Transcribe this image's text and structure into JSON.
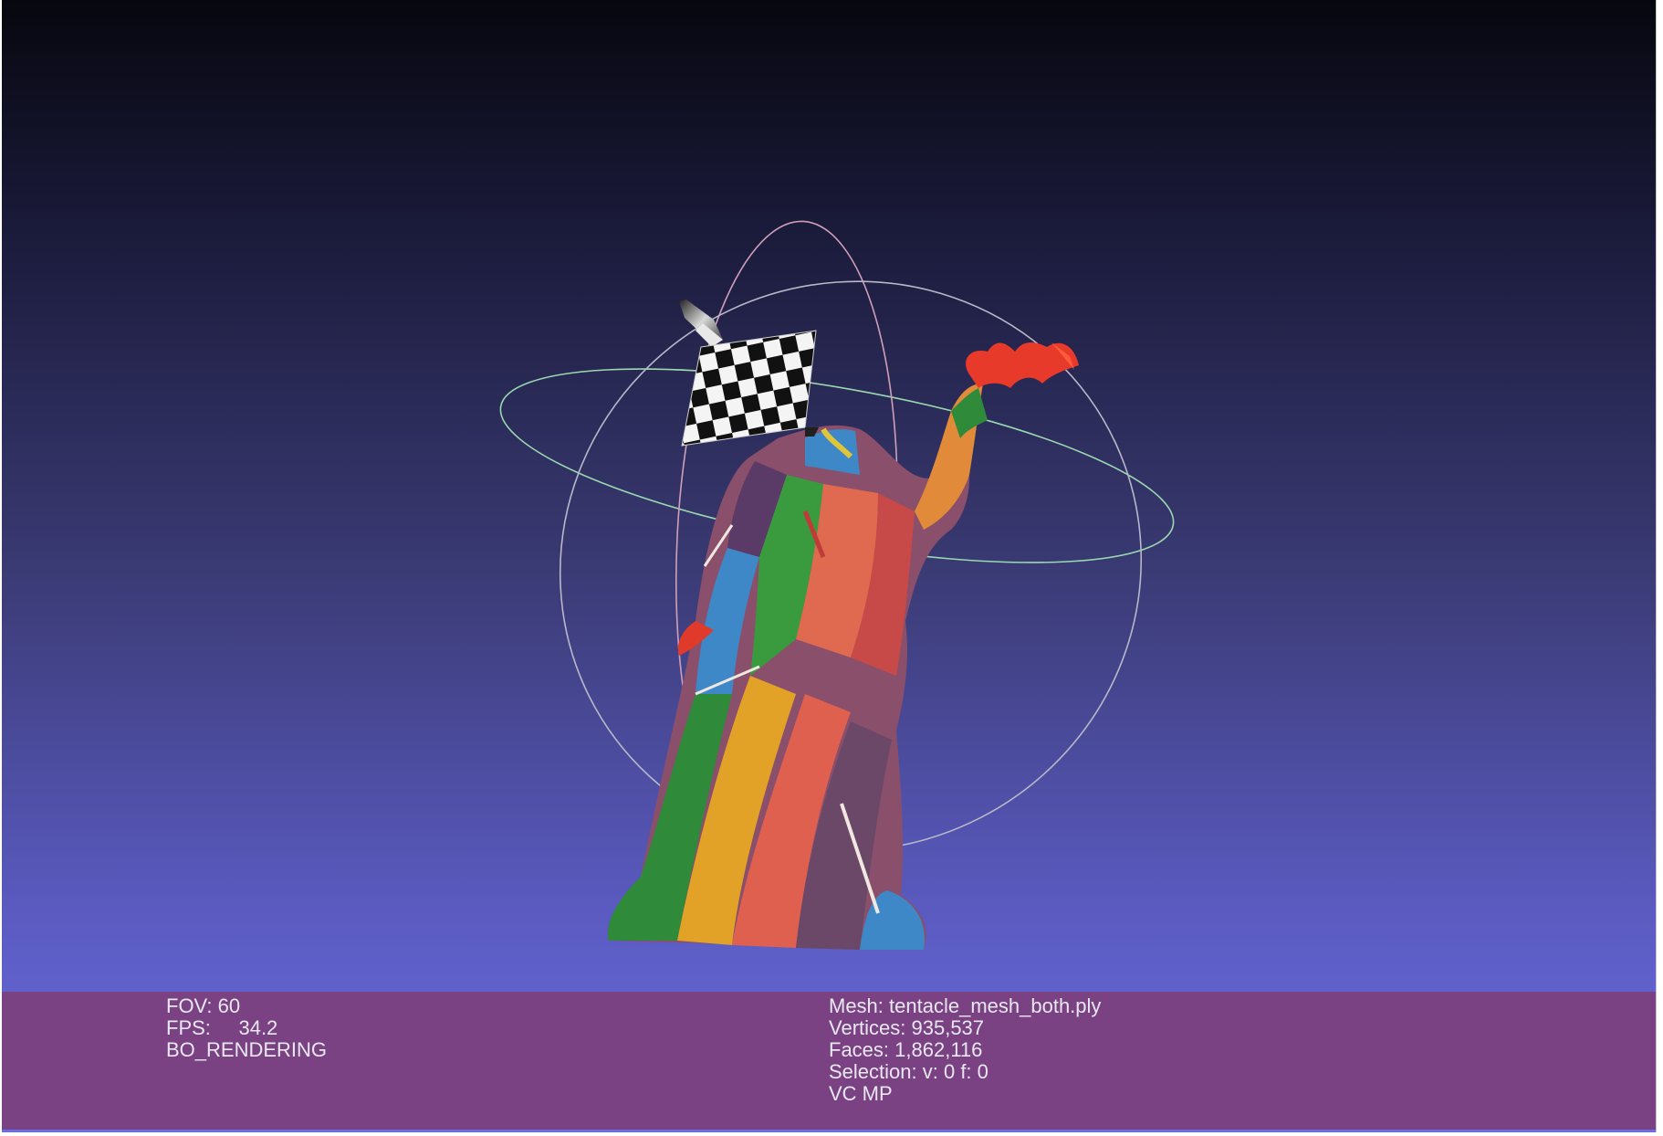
{
  "info_left": {
    "fov_label": "FOV:",
    "fov_value": "60",
    "fps_label": "FPS:",
    "fps_value": "34.2",
    "render_mode": "BO_RENDERING"
  },
  "info_right": {
    "mesh_label": "Mesh:",
    "mesh_name": "tentacle_mesh_both.ply",
    "vertices_label": "Vertices:",
    "vertices_value": "935,537",
    "faces_label": "Faces:",
    "faces_value": "1,862,116",
    "selection_label": "Selection:",
    "selection_value": "v: 0 f: 0",
    "color_mode": "VC MP"
  },
  "colors": {
    "bar_bg": "#7a4283",
    "bg_top": "#07070f",
    "bg_bottom": "#6b6ce0",
    "trackball_x": "#9ad8b0",
    "trackball_y": "#d0a0b8",
    "trackball_z": "#b8b8c8"
  }
}
